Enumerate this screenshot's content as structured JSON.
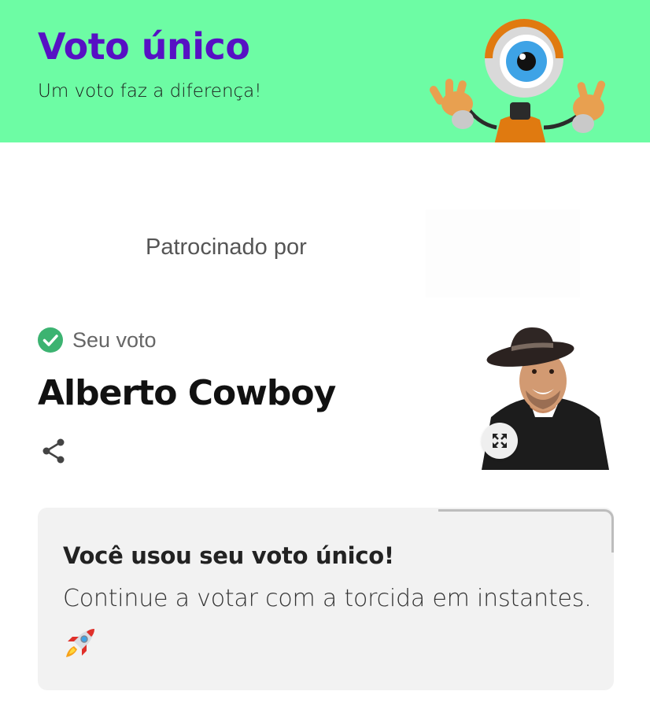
{
  "header": {
    "title": "Voto único",
    "subtitle": "Um voto faz a diferença!",
    "background_color": "#6dfca4",
    "title_color": "#5710c4",
    "mascot_icon": "eye-robot-mascot"
  },
  "sponsor": {
    "label": "Patrocinado por"
  },
  "vote": {
    "status_label": "Seu voto",
    "status_icon": "check-circle-icon",
    "status_color": "#3cb371",
    "candidate_name": "Alberto Cowboy",
    "share_icon": "share-icon",
    "expand_icon": "expand-icon"
  },
  "notice": {
    "title": "Você usou seu voto único!",
    "message": "Continue a votar com a torcida em instantes.",
    "emoji_icon": "rocket-icon"
  }
}
